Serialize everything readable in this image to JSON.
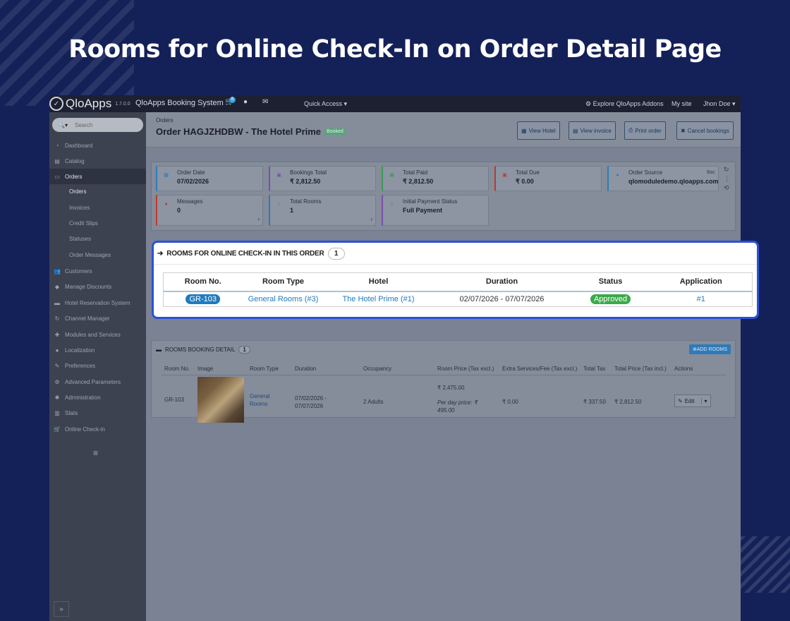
{
  "hero": {
    "title": "Rooms for Online Check-In on Order Detail Page"
  },
  "topbar": {
    "logo_name": "QloApps",
    "logo_version": "1.7.0.0",
    "brand": "QloApps Booking System",
    "cart_count": "6",
    "quick_access": "Quick Access",
    "explore": "Explore QloApps Addons",
    "my_site": "My site",
    "user": "Jhon Doe"
  },
  "sidebar": {
    "search_placeholder": "Search",
    "items": [
      {
        "label": "Dashboard",
        "icon": "dashboard-icon"
      },
      {
        "label": "Catalog",
        "icon": "book-icon"
      },
      {
        "label": "Orders",
        "icon": "credit-card-icon"
      },
      {
        "label": "Customers",
        "icon": "users-icon"
      },
      {
        "label": "Manage Discounts",
        "icon": "tag-icon"
      },
      {
        "label": "Hotel Reservation System",
        "icon": "bed-icon"
      },
      {
        "label": "Channel Manager",
        "icon": "sync-icon"
      },
      {
        "label": "Modules and Services",
        "icon": "puzzle-icon"
      },
      {
        "label": "Localization",
        "icon": "globe-icon"
      },
      {
        "label": "Preferences",
        "icon": "wrench-icon"
      },
      {
        "label": "Advanced Parameters",
        "icon": "cogs-icon"
      },
      {
        "label": "Administration",
        "icon": "gear-icon"
      },
      {
        "label": "Stats",
        "icon": "bar-chart-icon"
      },
      {
        "label": "Online Check-in",
        "icon": "cart-icon"
      }
    ],
    "order_subs": [
      "Orders",
      "Invoices",
      "Credit Slips",
      "Statuses",
      "Order Messages"
    ]
  },
  "header": {
    "breadcrumb": "Orders",
    "title": "Order HAGJZHDBW - The Hotel Prime",
    "status_badge": "Booked",
    "actions": [
      "View Hotel",
      "View invoice",
      "Print order",
      "Cancel bookings"
    ]
  },
  "kpis": [
    {
      "label": "Order Date",
      "value": "07/02/2026",
      "color": "#2f7ab8"
    },
    {
      "label": "Bookings Total",
      "value": "₹ 2,812.50",
      "color": "#7b4fa8"
    },
    {
      "label": "Total Paid",
      "value": "₹ 2,812.50",
      "color": "#3a9a55"
    },
    {
      "label": "Total Due",
      "value": "₹ 0.00",
      "color": "#c0392b"
    },
    {
      "label": "Order Source",
      "value": "qlomoduledemo.qloapps.com",
      "extra": "Bac",
      "color": "#2f7ab8"
    },
    {
      "label": "Messages",
      "value": "0",
      "color": "#c0392b"
    },
    {
      "label": "Total Rooms",
      "value": "1",
      "color": "#2f7ab8"
    },
    {
      "label": "Initial Payment Status",
      "value": "Full Payment",
      "color": "#7b4fa8"
    }
  ],
  "checkin": {
    "title": "ROOMS FOR ONLINE CHECK-IN IN THIS ORDER",
    "count": "1",
    "headers": [
      "Room No.",
      "Room Type",
      "Hotel",
      "Duration",
      "Status",
      "Application"
    ],
    "row": {
      "room_no": "GR-103",
      "room_type": "General Rooms (#3)",
      "hotel": "The Hotel Prime (#1)",
      "duration": "02/07/2026 - 07/07/2026",
      "status": "Approved",
      "application": "#1"
    }
  },
  "booking_detail": {
    "title": "ROOMS BOOKING DETAIL",
    "count": "1",
    "add_button": "ADD ROOMS",
    "headers": [
      "Room No.",
      "Image",
      "Room Type",
      "Duration",
      "Occupancy",
      "Room Price (Tax excl.)",
      "Extra Services/Fee (Tax excl.)",
      "Total Tax",
      "Total Price (Tax incl.)",
      "Actions"
    ],
    "row": {
      "room_no": "GR-103",
      "room_type_1": "General",
      "room_type_2": "Rooms",
      "duration_1": "07/02/2026 -",
      "duration_2": "07/07/2026",
      "occupancy": "2 Adults",
      "room_price": "₹ 2,475.00",
      "per_day_1": "Per day price: ₹",
      "per_day_2": "495.00",
      "extra": "₹ 0.00",
      "tax": "₹ 337.50",
      "total": "₹ 2,812.50",
      "edit": "Edit"
    }
  }
}
